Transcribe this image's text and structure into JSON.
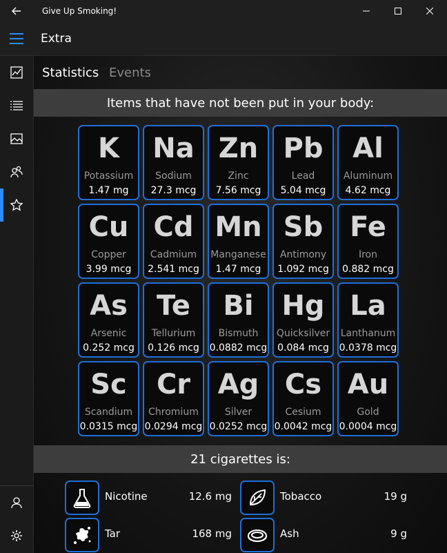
{
  "window": {
    "title": "Give Up Smoking!"
  },
  "header": {
    "title": "Extra"
  },
  "sidebar": {
    "items": [
      {
        "icon": "chart-icon",
        "active": false
      },
      {
        "icon": "list-icon",
        "active": false
      },
      {
        "icon": "image-icon",
        "active": false
      },
      {
        "icon": "people-icon",
        "active": false
      },
      {
        "icon": "star-icon",
        "active": true
      }
    ],
    "bottom": [
      {
        "icon": "person-icon"
      },
      {
        "icon": "gear-icon"
      }
    ]
  },
  "tabs": [
    {
      "label": "Statistics",
      "selected": true
    },
    {
      "label": "Events",
      "selected": false
    }
  ],
  "elements_header": "Items that have not been put in your body:",
  "elements": [
    {
      "symbol": "K",
      "name": "Potassium",
      "amount": "1.47 mg"
    },
    {
      "symbol": "Na",
      "name": "Sodium",
      "amount": "27.3 mcg"
    },
    {
      "symbol": "Zn",
      "name": "Zinc",
      "amount": "7.56 mcg"
    },
    {
      "symbol": "Pb",
      "name": "Lead",
      "amount": "5.04 mcg"
    },
    {
      "symbol": "Al",
      "name": "Aluminum",
      "amount": "4.62 mcg"
    },
    {
      "symbol": "Cu",
      "name": "Copper",
      "amount": "3.99 mcg"
    },
    {
      "symbol": "Cd",
      "name": "Cadmium",
      "amount": "2.541 mcg"
    },
    {
      "symbol": "Mn",
      "name": "Manganese",
      "amount": "1.47 mcg"
    },
    {
      "symbol": "Sb",
      "name": "Antimony",
      "amount": "1.092 mcg"
    },
    {
      "symbol": "Fe",
      "name": "Iron",
      "amount": "0.882 mcg"
    },
    {
      "symbol": "As",
      "name": "Arsenic",
      "amount": "0.252 mcg"
    },
    {
      "symbol": "Te",
      "name": "Tellurium",
      "amount": "0.126 mcg"
    },
    {
      "symbol": "Bi",
      "name": "Bismuth",
      "amount": "0.0882 mcg"
    },
    {
      "symbol": "Hg",
      "name": "Quicksilver",
      "amount": "0.084 mcg"
    },
    {
      "symbol": "La",
      "name": "Lanthanum",
      "amount": "0.0378 mcg"
    },
    {
      "symbol": "Sc",
      "name": "Scandium",
      "amount": "0.0315 mcg"
    },
    {
      "symbol": "Cr",
      "name": "Chromium",
      "amount": "0.0294 mcg"
    },
    {
      "symbol": "Ag",
      "name": "Silver",
      "amount": "0.0252 mcg"
    },
    {
      "symbol": "Cs",
      "name": "Cesium",
      "amount": "0.0042 mcg"
    },
    {
      "symbol": "Au",
      "name": "Gold",
      "amount": "0.0004 mcg"
    }
  ],
  "cigarettes_header": "21 cigarettes is:",
  "cigarettes": [
    {
      "icon": "flask-icon",
      "label": "Nicotine",
      "value": "12.6 mg"
    },
    {
      "icon": "leaf-icon",
      "label": "Tobacco",
      "value": "19 g"
    },
    {
      "icon": "splat-icon",
      "label": "Tar",
      "value": "168 mg"
    },
    {
      "icon": "ash-icon",
      "label": "Ash",
      "value": "9 g"
    }
  ],
  "colors": {
    "accent": "#1e6fd9",
    "nav_accent": "#2b8cff",
    "section_bar": "#3d3d3d"
  }
}
